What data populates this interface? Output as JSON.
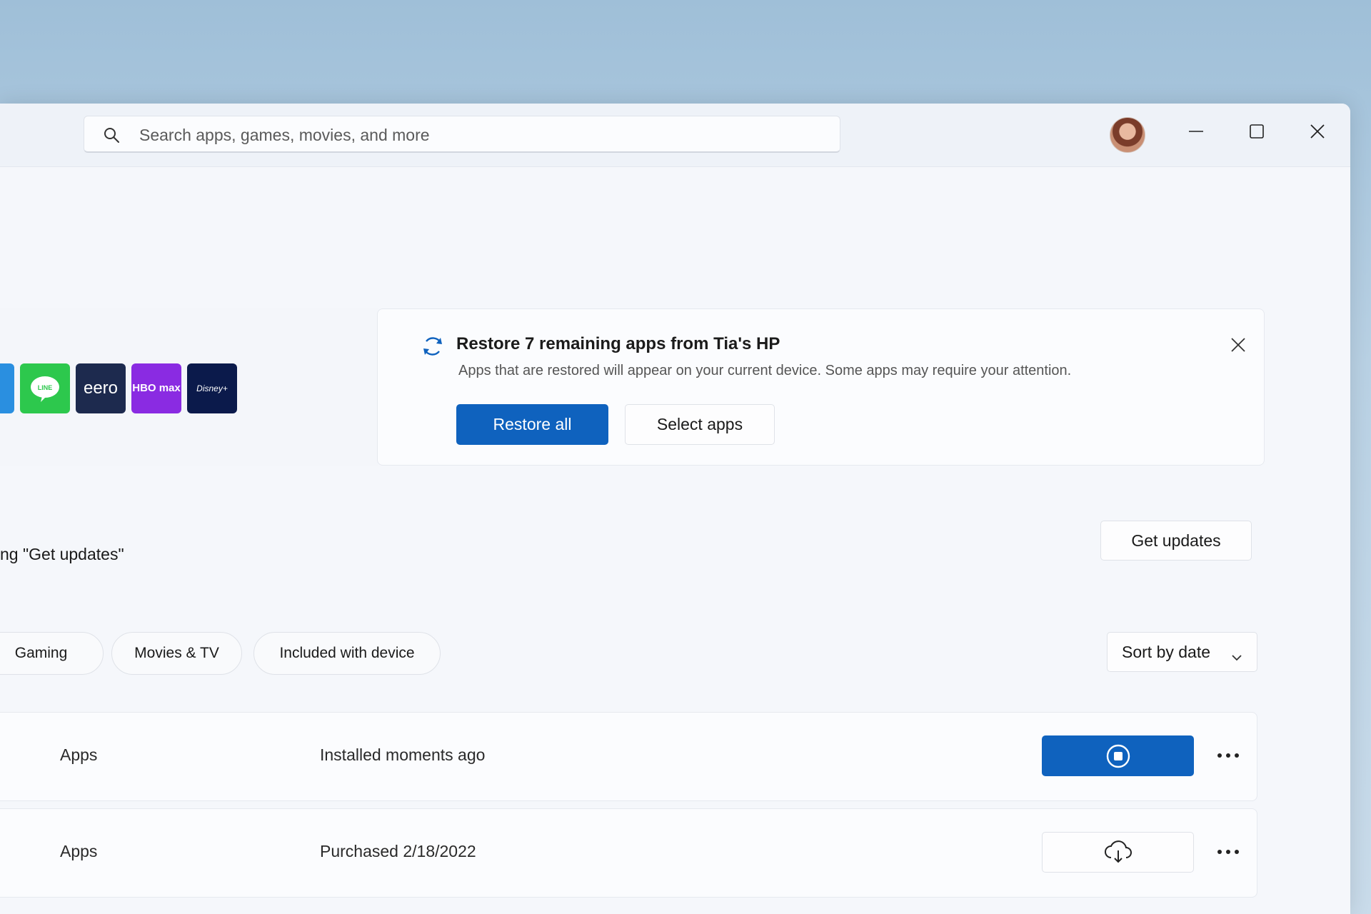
{
  "search": {
    "placeholder": "Search apps, games, movies, and more"
  },
  "restore_card": {
    "title": "Restore 7 remaining apps from Tia's HP",
    "subtitle": "Apps that are restored will appear on your current device. Some apps may require your attention.",
    "primary_button": "Restore all",
    "secondary_button": "Select apps"
  },
  "app_tiles": [
    {
      "name": "line-app-icon",
      "label": "LINE",
      "color": "#2dc84d"
    },
    {
      "name": "eero-app-icon",
      "label": "eero",
      "color": "#1d2a4e"
    },
    {
      "name": "hbomax-app-icon",
      "label": "HBO max",
      "color": "#8a2be2"
    },
    {
      "name": "disney-plus-app-icon",
      "label": "Disney+",
      "color": "#0b1a4b"
    }
  ],
  "updates": {
    "hint": "ng \"Get updates\"",
    "button": "Get updates"
  },
  "filters": {
    "gaming": "Gaming",
    "movies_tv": "Movies & TV",
    "included": "Included with device",
    "sort": "Sort by date"
  },
  "rows": [
    {
      "category": "Apps",
      "status": "Installed moments ago",
      "action": "stop-install"
    },
    {
      "category": "Apps",
      "status": "Purchased 2/18/2022",
      "action": "download"
    }
  ],
  "colors": {
    "accent": "#0f62be",
    "window_bg": "#f5f7fb",
    "desktop_bg": "#a9c6dd"
  }
}
